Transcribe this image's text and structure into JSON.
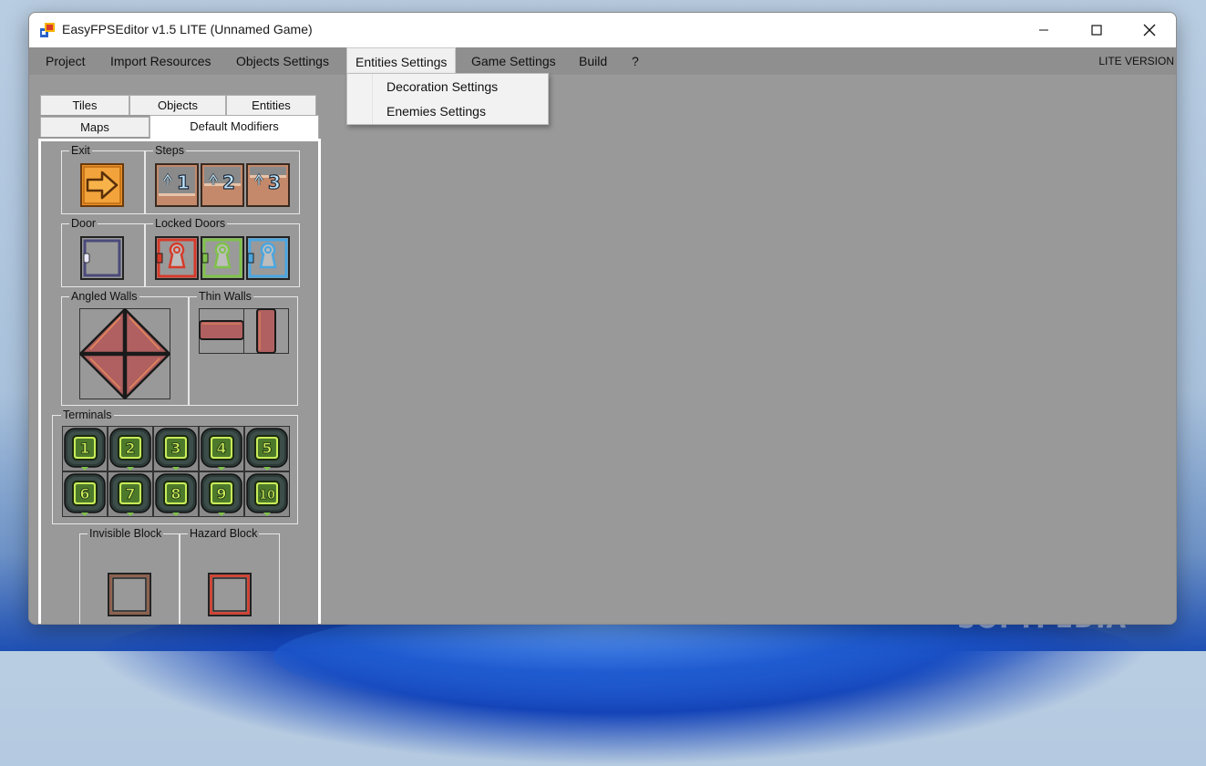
{
  "window": {
    "title": "EasyFPSEditor v1.5 LITE (Unnamed Game)",
    "controls": {
      "minimize": "minimize-icon",
      "maximize": "maximize-icon",
      "close": "close-icon"
    }
  },
  "menubar": {
    "items": [
      "Project",
      "Import Resources",
      "Objects Settings",
      "Entities Settings",
      "Game Settings",
      "Build",
      "?"
    ],
    "active_item": "Entities Settings",
    "right_label": "LITE VERSION"
  },
  "dropdown": {
    "items": [
      "Decoration Settings",
      "Enemies Settings"
    ]
  },
  "tabs": {
    "row_top": [
      "Tiles",
      "Objects",
      "Entities"
    ],
    "row_bottom": [
      "Maps",
      "Default Modifiers"
    ],
    "selected": "Default Modifiers"
  },
  "groups": {
    "exit": "Exit",
    "steps": "Steps",
    "door": "Door",
    "locked_doors": "Locked Doors",
    "angled_walls": "Angled Walls",
    "thin_walls": "Thin Walls",
    "terminals": "Terminals",
    "invisible_block": "Invisible Block",
    "hazard_block": "Hazard Block"
  },
  "steps": [
    "1",
    "2",
    "3"
  ],
  "terminals": [
    "1",
    "2",
    "3",
    "4",
    "5",
    "6",
    "7",
    "8",
    "9",
    "10"
  ],
  "watermark": "SOFTPEDIA",
  "colors": {
    "menubar": "#8f8f8f",
    "workspace": "#999999",
    "lock_red": "#d63a2a",
    "lock_green": "#7fc24a",
    "lock_blue": "#4aa6e0",
    "terminal_green": "#c9ec5a"
  }
}
